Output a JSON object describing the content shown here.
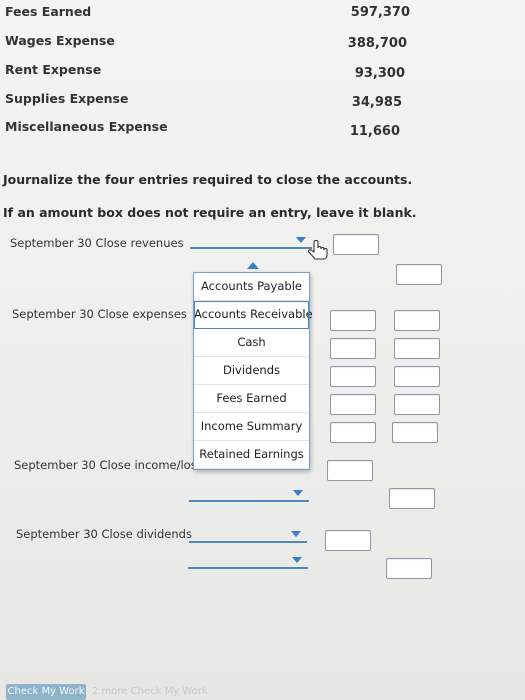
{
  "accounts": [
    {
      "name": "Fees Earned",
      "amount": "597,370"
    },
    {
      "name": "Wages Expense",
      "amount": "388,700"
    },
    {
      "name": "Rent Expense",
      "amount": "93,300"
    },
    {
      "name": "Supplies Expense",
      "amount": "34,985"
    },
    {
      "name": "Miscellaneous Expense",
      "amount": "11,660"
    }
  ],
  "instructions": {
    "line1": "Journalize the four entries required to close the accounts.",
    "line2": "If an amount box does not require an entry, leave it blank."
  },
  "entries": {
    "revenues": "September 30 Close revenues",
    "expenses": "September 30 Close expenses",
    "income_loss": "September 30 Close income/loss",
    "dividends": "September 30 Close dividends"
  },
  "dropdown_options": [
    "Accounts Payable",
    "Accounts Receivable",
    "Cash",
    "Dividends",
    "Fees Earned",
    "Income Summary",
    "Retained Earnings"
  ],
  "footer": {
    "check_button": "Check My Work",
    "more": "2 more Check My Work"
  },
  "colors": {
    "select_border": "#4d86b8",
    "arrow": "#3a7fc4",
    "button_bg": "#8fb3c9"
  }
}
